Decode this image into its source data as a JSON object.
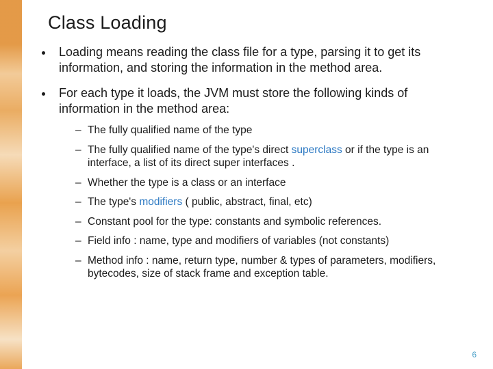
{
  "title": "Class Loading",
  "bullets": {
    "b1": "Loading means reading the class file for a type, parsing it to get its information, and storing the information in the method area.",
    "b2": "For each type it loads, the JVM must store the following kinds of information in the method area:",
    "sub": {
      "s1": "The fully qualified name of the type",
      "s2a": "The fully qualified name of the type's direct ",
      "s2kw": "superclass",
      "s2b": " or if the type is an interface, a list of its direct super interfaces .",
      "s3": "Whether the type is a class or an interface",
      "s4a": "The type's ",
      "s4kw": "modifiers",
      "s4b": " ( public, abstract, final, etc)",
      "s5": "Constant pool for the type: constants and symbolic references.",
      "s6": "Field info : name,  type and modifiers of variables (not constants)",
      "s7": "Method info :  name, return type, number & types of parameters, modifiers, bytecodes, size of stack frame and exception table."
    }
  },
  "page_number": "6"
}
